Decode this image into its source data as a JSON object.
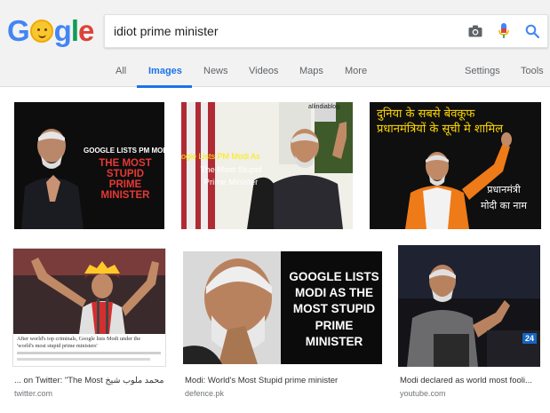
{
  "search": {
    "query": "idiot prime minister",
    "logo": {
      "letters": [
        "G",
        "o",
        "g",
        "l",
        "e"
      ],
      "colors": [
        "#4285f4",
        "#f4b400",
        "#4285f4",
        "#0f9d58",
        "#db4437"
      ]
    }
  },
  "tabs": [
    {
      "label": "All"
    },
    {
      "label": "Images"
    },
    {
      "label": "News"
    },
    {
      "label": "Videos"
    },
    {
      "label": "Maps"
    },
    {
      "label": "More"
    }
  ],
  "tools": {
    "settings": "Settings",
    "tools": "Tools"
  },
  "results": [
    {
      "headline_white": "GOOGLE LISTS PM MODI AS",
      "headline_red": "THE MOST STUPID\nPRIME MINISTER"
    },
    {
      "watermark": "allindiablog.",
      "headline_yellow": "ogle Lists PM Modi As",
      "headline_white": "The Most Stupid\nPrime Minister"
    },
    {
      "hindi_top": "दुनिया के सबसे बेवकूफ\nप्रधानमंत्रियों के सूची मे शामिल",
      "hindi_bottom": "प्रधानमंत्री\nमोदी का नाम"
    },
    {
      "banner_line1": "After world's top criminals, Google lists Modi under the",
      "banner_line2": "'world's most stupid prime ministers'",
      "caption": "... on Twitter: \"The Most محمد ملوب شیخ",
      "source": "twitter.com"
    },
    {
      "headline": "GOOGLE LISTS\nMODI AS THE\nMOST STUPID\nPRIME\nMINISTER",
      "caption": "Modi: World's Most Stupid prime minister",
      "source": "defence.pk"
    },
    {
      "badge": "24",
      "caption": "Modi declared as world most fooli...",
      "source": "youtube.com"
    }
  ],
  "colors": {
    "accent": "#1a73e8",
    "headline_red": "#e53935",
    "hindi_yellow": "#ffd600"
  }
}
